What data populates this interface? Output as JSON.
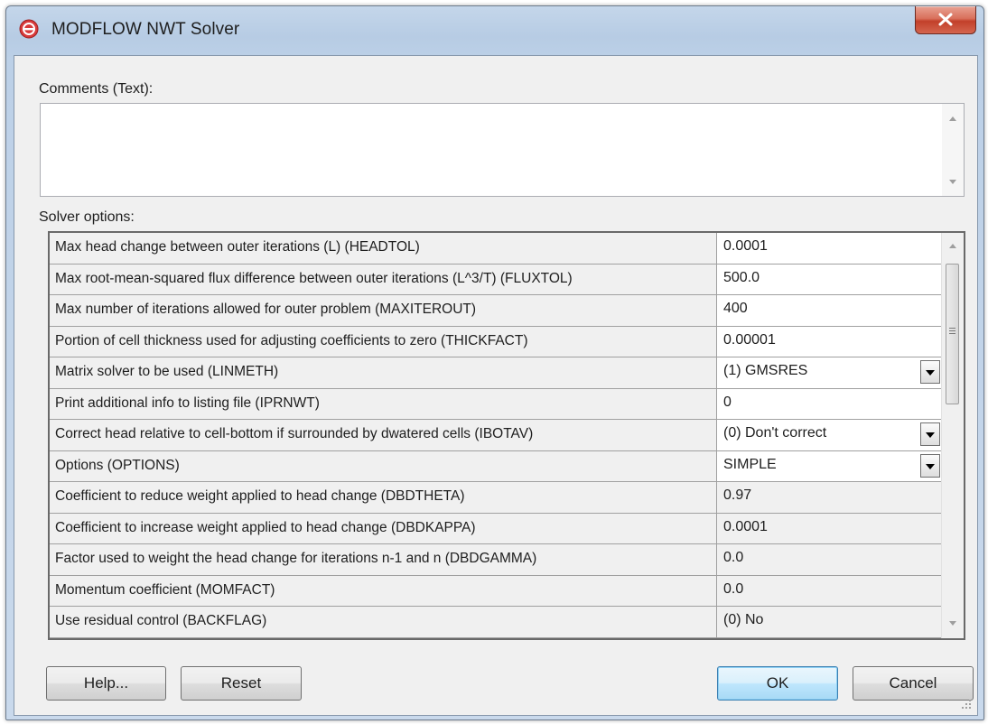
{
  "window": {
    "title": "MODFLOW NWT Solver"
  },
  "comments": {
    "label": "Comments (Text):",
    "value": ""
  },
  "solver": {
    "label": "Solver options:",
    "rows": [
      {
        "label": "Max head change between outer iterations (L) (HEADTOL)",
        "value": "0.0001",
        "editable": true,
        "dropdown": false
      },
      {
        "label": "Max root-mean-squared flux difference between outer iterations (L^3/T) (FLUXTOL)",
        "value": "500.0",
        "editable": true,
        "dropdown": false
      },
      {
        "label": "Max number of iterations allowed for outer problem (MAXITEROUT)",
        "value": "400",
        "editable": true,
        "dropdown": false
      },
      {
        "label": "Portion of cell thickness used for adjusting coefficients to zero (THICKFACT)",
        "value": "0.00001",
        "editable": true,
        "dropdown": false
      },
      {
        "label": "Matrix solver to be used (LINMETH)",
        "value": "(1) GMSRES",
        "editable": true,
        "dropdown": true
      },
      {
        "label": "Print additional info to listing file (IPRNWT)",
        "value": "0",
        "editable": true,
        "dropdown": false
      },
      {
        "label": "Correct head relative to cell-bottom if surrounded by dwatered cells (IBOTAV)",
        "value": "(0) Don't correct",
        "editable": true,
        "dropdown": true
      },
      {
        "label": "Options (OPTIONS)",
        "value": "SIMPLE",
        "editable": true,
        "dropdown": true
      },
      {
        "label": "Coefficient to reduce weight applied to head change (DBDTHETA)",
        "value": "0.97",
        "editable": false,
        "dropdown": false
      },
      {
        "label": "Coefficient to increase weight applied to head change (DBDKAPPA)",
        "value": "0.0001",
        "editable": false,
        "dropdown": false
      },
      {
        "label": "Factor used to weight the head change for iterations n-1 and n (DBDGAMMA)",
        "value": "0.0",
        "editable": false,
        "dropdown": false
      },
      {
        "label": "Momentum coefficient (MOMFACT)",
        "value": "0.0",
        "editable": false,
        "dropdown": false
      },
      {
        "label": "Use residual control (BACKFLAG)",
        "value": "(0) No",
        "editable": false,
        "dropdown": false
      }
    ]
  },
  "buttons": {
    "help": "Help...",
    "reset": "Reset",
    "ok": "OK",
    "cancel": "Cancel"
  },
  "icons": {
    "app": "gms-logo-icon",
    "close": "close-icon"
  },
  "colors": {
    "titlebar": "#bcd0e7",
    "close_button": "#c2402a",
    "default_button_border": "#3c7fb1"
  }
}
